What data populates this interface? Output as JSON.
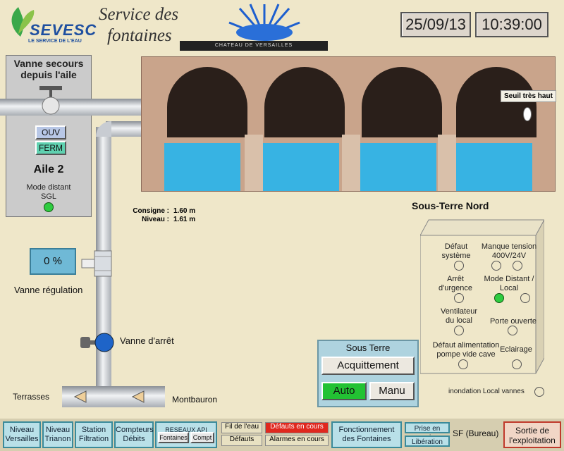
{
  "header": {
    "logo_name": "SEVESC",
    "logo_sub": "LE SERVICE DE L'EAU",
    "title_line1": "Service des",
    "title_line2": "fontaines",
    "banner": "CHATEAU DE VERSAILLES",
    "date": "25/09/13",
    "time": "10:39:00"
  },
  "left_panel": {
    "title_line1": "Vanne secours",
    "title_line2": "depuis l'aile",
    "btn_open": "OUV",
    "btn_close": "FERM",
    "wing": "Aile 2",
    "mode_line1": "Mode distant",
    "mode_line2": "SGL"
  },
  "scene": {
    "threshold_label": "Seuil très haut",
    "area_title": "Sous-Terre Nord"
  },
  "readings": {
    "consigne_label": "Consigne :",
    "consigne_value": "1.60 m",
    "niveau_label": "Niveau :",
    "niveau_value": "1.61 m"
  },
  "regulation": {
    "value": "0 %",
    "label": "Vanne régulation",
    "stop_valve_label": "Vanne d'arrêt",
    "left_outlet": "Terrasses",
    "right_outlet": "Montbauron"
  },
  "status_box": {
    "default_system": "Défaut système",
    "power_fault": "Manque tension 400V/24V",
    "emergency_stop": "Arrêt d'urgence",
    "mode": "Mode Distant / Local",
    "ventilation": "Ventilateur du local",
    "door": "Porte ouverte",
    "pump_fault": "Défaut alimentation pompe vide cave",
    "lighting": "Eclairage",
    "flood_label": "inondation Local vannes"
  },
  "control": {
    "title": "Sous Terre",
    "ack": "Acquittement",
    "auto": "Auto",
    "manual": "Manu"
  },
  "nav": {
    "niveau_versailles": "Niveau Versailles",
    "niveau_trianon": "Niveau Trianon",
    "station_filtration": "Station Filtration",
    "compteurs_debits": "Compteurs Débits",
    "reseaux_api": "RESEAUX API",
    "fontaines": "Fontaines",
    "compt": "Compt",
    "fil_eau": "Fil de l'eau",
    "defauts": "Défauts",
    "defauts_en_cours": "Défauts en cours",
    "alarmes_en_cours": "Alarmes en cours",
    "fonctionnement": "Fonctionnement des Fontaines",
    "prise_en_main": "Prise en main",
    "liberation": "Libération",
    "sf_bureau": "SF (Bureau)",
    "sortie": "Sortie de l'exploitation"
  },
  "colors": {
    "accent_red": "#e0281e",
    "water": "#37b3e3",
    "led_on": "#2ecc40"
  }
}
